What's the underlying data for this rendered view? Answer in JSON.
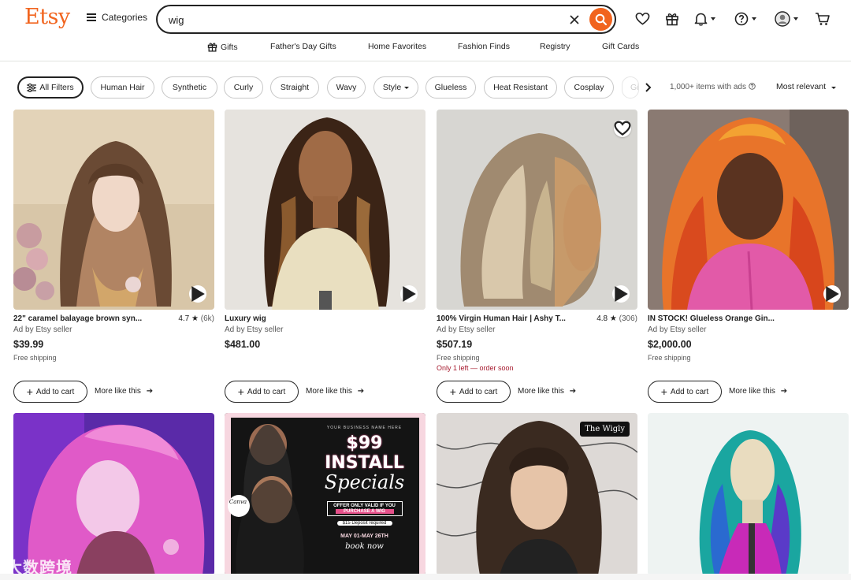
{
  "header": {
    "logo": "Etsy",
    "categories_label": "Categories",
    "search_value": "wig"
  },
  "subnav": [
    "Gifts",
    "Father's Day Gifts",
    "Home Favorites",
    "Fashion Finds",
    "Registry",
    "Gift Cards"
  ],
  "filters": {
    "all": "All Filters",
    "chips": [
      "Human Hair",
      "Synthetic",
      "Curly",
      "Straight",
      "Wavy",
      "Style",
      "Glueless",
      "Heat Resistant",
      "Cosplay",
      "Gi"
    ],
    "results_meta": "1,000+ items with ads",
    "sort_label": "Most relevant"
  },
  "listings": [
    {
      "title": "22\" caramel balayage brown syn...",
      "rating": "4.7",
      "reviews": "(6k)",
      "ad": "Ad by Etsy seller",
      "price": "$39.99",
      "shipping": "Free shipping",
      "stock": "",
      "cart": "Add to cart",
      "more": "More like this"
    },
    {
      "title": "Luxury wig",
      "rating": "",
      "reviews": "",
      "ad": "Ad by Etsy seller",
      "price": "$481.00",
      "shipping": "",
      "stock": "",
      "cart": "Add to cart",
      "more": "More like this"
    },
    {
      "title": "100% Virgin Human Hair | Ashy T...",
      "rating": "4.8",
      "reviews": "(306)",
      "ad": "Ad by Etsy seller",
      "price": "$507.19",
      "shipping": "Free shipping",
      "stock": "Only 1 left — order soon",
      "cart": "Add to cart",
      "more": "More like this"
    },
    {
      "title": "IN STOCK! Glueless Orange Gin...",
      "rating": "",
      "reviews": "",
      "ad": "Ad by Etsy seller",
      "price": "$2,000.00",
      "shipping": "Free shipping",
      "stock": "",
      "cart": "Add to cart",
      "more": "More like this"
    }
  ],
  "row2": {
    "badge": "The Wigly",
    "flyer": {
      "top": "YOUR BUSINESS NAME HERE",
      "headline1": "$99 INSTALL",
      "headline2": "Specials",
      "offer1": "OFFER ONLY VALID IF YOU",
      "offer2": "PURCHASE A WIG",
      "deposit": "$15 Deposit required",
      "dates": "MAY 01-MAY 26TH",
      "cta": "book now",
      "brand": "Canva"
    }
  },
  "watermark": "大数跨境",
  "colors": {
    "brand": "#F1641E",
    "stock_red": "#a61a2e",
    "text": "#222222",
    "muted": "#595959"
  }
}
